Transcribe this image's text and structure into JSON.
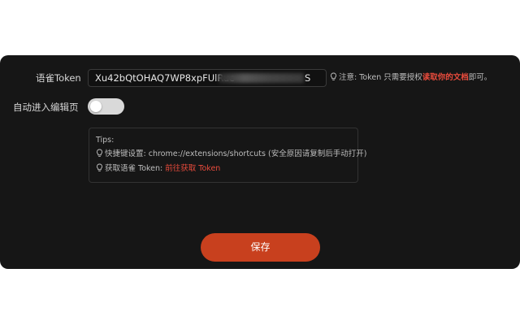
{
  "colors": {
    "panel": "#161616",
    "accent": "#c8401e",
    "link_red": "#e84b3c"
  },
  "token": {
    "label": "语雀Token",
    "value_prefix": "Xu42bQtOHAQ7WP8xpFUlRuc",
    "value_suffix": "S",
    "note_prefix": "注意: Token 只需要授权",
    "note_link": "读取你的文档",
    "note_suffix": "即可。",
    "note_icon": "lightbulb-icon"
  },
  "auto_edit": {
    "label": "自动进入编辑页",
    "enabled": false
  },
  "tips": {
    "title": "Tips:",
    "shortcut_text": "快捷键设置: chrome://extensions/shortcuts (安全原因请复制后手动打开)",
    "get_token_prefix": "获取语雀 Token: ",
    "get_token_link": "前往获取 Token"
  },
  "save_label": "保存"
}
